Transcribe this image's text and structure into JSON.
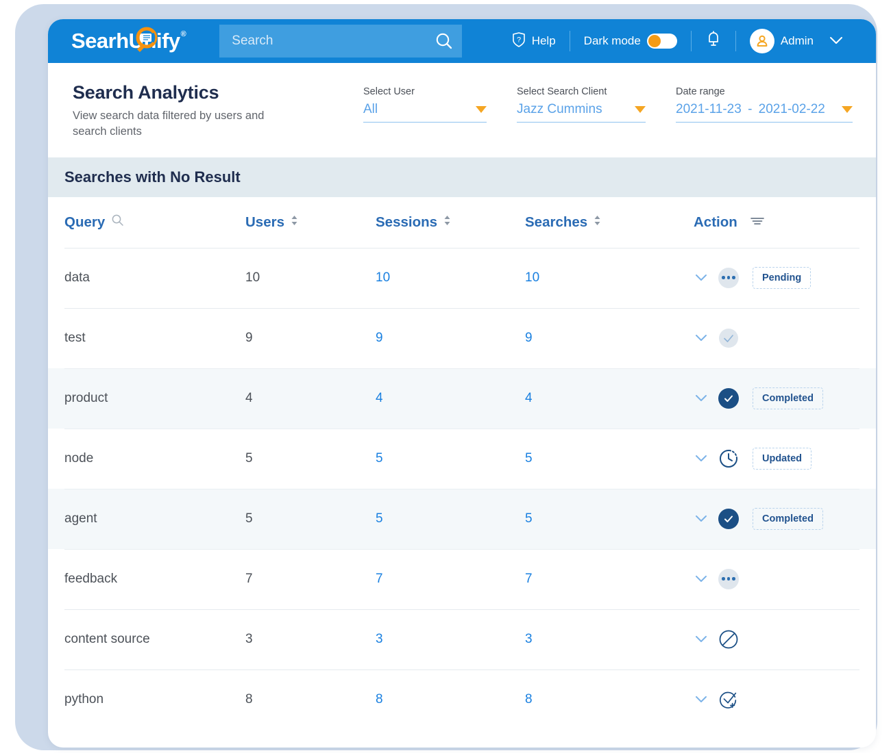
{
  "header": {
    "logo_text_1": "Sear",
    "logo_text_2": "hUnify",
    "logo_registered": "®",
    "logo_icon": "magnifier-logo-icon",
    "search": {
      "placeholder": "Search",
      "value": "",
      "icon": "search-icon"
    },
    "help_label": "Help",
    "help_icon": "help-shield-icon",
    "dark_mode_label": "Dark mode",
    "dark_mode_on": true,
    "bell_icon": "notification-bell-icon",
    "avatar_icon": "user-avatar-icon",
    "user_name": "Admin",
    "user_caret_icon": "chevron-down-icon",
    "bar_color": "#1083d6",
    "search_bg_color": "#3f9ee0",
    "accent_orange": "#f59b14"
  },
  "page": {
    "title": "Search Analytics",
    "subtitle": "View search data filtered by users and search clients"
  },
  "filters": [
    {
      "label": "Select User",
      "value": "All",
      "caret_icon": "dropdown-caret-icon"
    },
    {
      "label": "Select Search Client",
      "value": "Jazz Cummins",
      "caret_icon": "dropdown-caret-icon"
    },
    {
      "label": "Date range",
      "value_start": "2021-11-23",
      "value_sep": "-",
      "value_end": "2021-02-22",
      "caret_icon": "dropdown-caret-icon"
    }
  ],
  "section": {
    "banner_title": "Searches with No Result",
    "banner_color": "#e1eaef"
  },
  "table": {
    "columns": [
      {
        "label": "Query",
        "icon": "search-icon"
      },
      {
        "label": "Users",
        "icon": "sort-arrows-icon"
      },
      {
        "label": "Sessions",
        "icon": "sort-arrows-icon"
      },
      {
        "label": "Searches",
        "icon": "sort-arrows-icon"
      },
      {
        "label": "Action",
        "icon": "filter-lines-icon"
      }
    ],
    "header_color": "#2a6bb4",
    "link_color": "#1a80e0",
    "rows": [
      {
        "query": "data",
        "users": "10",
        "sessions": "10",
        "searches": "10",
        "status_icon": "more-dots-icon",
        "badge": "Pending",
        "highlighted": false
      },
      {
        "query": "test",
        "users": "9",
        "sessions": "9",
        "searches": "9",
        "status_icon": "check-light-icon",
        "badge": "",
        "highlighted": false
      },
      {
        "query": "product",
        "users": "4",
        "sessions": "4",
        "searches": "4",
        "status_icon": "check-filled-icon",
        "badge": "Completed",
        "highlighted": true
      },
      {
        "query": "node",
        "users": "5",
        "sessions": "5",
        "searches": "5",
        "status_icon": "clock-history-icon",
        "badge": "Updated",
        "highlighted": false
      },
      {
        "query": "agent",
        "users": "5",
        "sessions": "5",
        "searches": "5",
        "status_icon": "check-filled-icon",
        "badge": "Completed",
        "highlighted": true
      },
      {
        "query": "feedback",
        "users": "7",
        "sessions": "7",
        "searches": "7",
        "status_icon": "more-dots-icon",
        "badge": "",
        "highlighted": false
      },
      {
        "query": "content source",
        "users": "3",
        "sessions": "3",
        "searches": "3",
        "status_icon": "block-slash-icon",
        "badge": "",
        "highlighted": false
      },
      {
        "query": "python",
        "users": "8",
        "sessions": "8",
        "searches": "8",
        "status_icon": "check-plus-icon",
        "badge": "",
        "highlighted": false
      }
    ],
    "row_expand_icon": "chevron-down-icon"
  }
}
